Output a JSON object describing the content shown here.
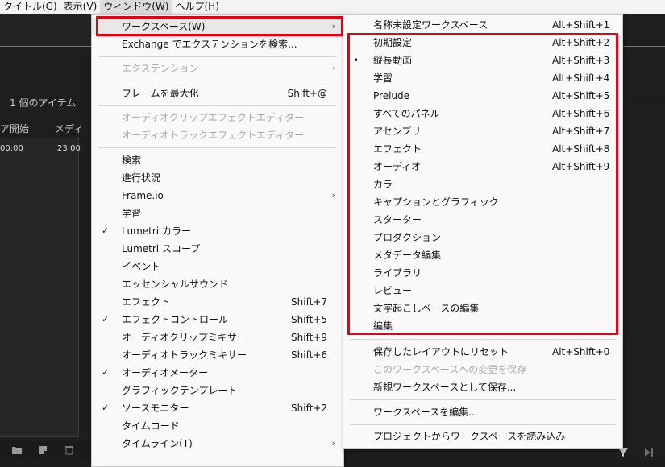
{
  "menubar": {
    "items": [
      "タイトル(G)",
      "表示(V)",
      "ウィンドウ(W)",
      "ヘルプ(H)"
    ]
  },
  "panel": {
    "item_count": "1 個のアイテム",
    "col1": "ア開始",
    "col2": "メディ",
    "cell1": "00:00",
    "cell2": "23:00"
  },
  "window_menu": {
    "items": [
      {
        "label": "ワークスペース(W)",
        "shortcut": "",
        "submenu": true,
        "disabled": false,
        "checked": false
      },
      {
        "label": "Exchange でエクステンションを検索...",
        "shortcut": "",
        "submenu": false,
        "disabled": false,
        "checked": false
      },
      {
        "label": "エクステンション",
        "shortcut": "",
        "submenu": true,
        "disabled": true,
        "checked": false
      },
      {
        "label": "フレームを最大化",
        "shortcut": "Shift+@",
        "submenu": false,
        "disabled": false,
        "checked": false
      },
      {
        "label": "オーディオクリップエフェクトエディター",
        "shortcut": "",
        "submenu": false,
        "disabled": true,
        "checked": false
      },
      {
        "label": "オーディオトラックエフェクトエディター",
        "shortcut": "",
        "submenu": false,
        "disabled": true,
        "checked": false
      },
      {
        "label": "検索",
        "shortcut": "",
        "submenu": false,
        "disabled": false,
        "checked": false
      },
      {
        "label": "進行状況",
        "shortcut": "",
        "submenu": false,
        "disabled": false,
        "checked": false
      },
      {
        "label": "Frame.io",
        "shortcut": "",
        "submenu": true,
        "disabled": false,
        "checked": false
      },
      {
        "label": "学習",
        "shortcut": "",
        "submenu": false,
        "disabled": false,
        "checked": false
      },
      {
        "label": "Lumetri カラー",
        "shortcut": "",
        "submenu": false,
        "disabled": false,
        "checked": true
      },
      {
        "label": "Lumetri スコープ",
        "shortcut": "",
        "submenu": false,
        "disabled": false,
        "checked": false
      },
      {
        "label": "イベント",
        "shortcut": "",
        "submenu": false,
        "disabled": false,
        "checked": false
      },
      {
        "label": "エッセンシャルサウンド",
        "shortcut": "",
        "submenu": false,
        "disabled": false,
        "checked": false
      },
      {
        "label": "エフェクト",
        "shortcut": "Shift+7",
        "submenu": false,
        "disabled": false,
        "checked": false
      },
      {
        "label": "エフェクトコントロール",
        "shortcut": "Shift+5",
        "submenu": false,
        "disabled": false,
        "checked": true
      },
      {
        "label": "オーディオクリップミキサー",
        "shortcut": "Shift+9",
        "submenu": false,
        "disabled": false,
        "checked": false
      },
      {
        "label": "オーディオトラックミキサー",
        "shortcut": "Shift+6",
        "submenu": false,
        "disabled": false,
        "checked": false
      },
      {
        "label": "オーディオメーター",
        "shortcut": "",
        "submenu": false,
        "disabled": false,
        "checked": true
      },
      {
        "label": "グラフィックテンプレート",
        "shortcut": "",
        "submenu": false,
        "disabled": false,
        "checked": false
      },
      {
        "label": "ソースモニター",
        "shortcut": "Shift+2",
        "submenu": false,
        "disabled": false,
        "checked": true
      },
      {
        "label": "タイムコード",
        "shortcut": "",
        "submenu": false,
        "disabled": false,
        "checked": false
      },
      {
        "label": "タイムライン(T)",
        "shortcut": "",
        "submenu": true,
        "disabled": false,
        "checked": false
      }
    ]
  },
  "workspace_menu": {
    "items": [
      {
        "label": "名称未設定ワークスペース",
        "shortcut": "Alt+Shift+1",
        "disabled": false,
        "current": false
      },
      {
        "label": "初期設定",
        "shortcut": "Alt+Shift+2",
        "disabled": false,
        "current": false
      },
      {
        "label": "縦長動画",
        "shortcut": "Alt+Shift+3",
        "disabled": false,
        "current": true
      },
      {
        "label": "学習",
        "shortcut": "Alt+Shift+4",
        "disabled": false,
        "current": false
      },
      {
        "label": "Prelude",
        "shortcut": "Alt+Shift+5",
        "disabled": false,
        "current": false
      },
      {
        "label": "すべてのパネル",
        "shortcut": "Alt+Shift+6",
        "disabled": false,
        "current": false
      },
      {
        "label": "アセンブリ",
        "shortcut": "Alt+Shift+7",
        "disabled": false,
        "current": false
      },
      {
        "label": "エフェクト",
        "shortcut": "Alt+Shift+8",
        "disabled": false,
        "current": false
      },
      {
        "label": "オーディオ",
        "shortcut": "Alt+Shift+9",
        "disabled": false,
        "current": false
      },
      {
        "label": "カラー",
        "shortcut": "",
        "disabled": false,
        "current": false
      },
      {
        "label": "キャプションとグラフィック",
        "shortcut": "",
        "disabled": false,
        "current": false
      },
      {
        "label": "スターター",
        "shortcut": "",
        "disabled": false,
        "current": false
      },
      {
        "label": "プロダクション",
        "shortcut": "",
        "disabled": false,
        "current": false
      },
      {
        "label": "メタデータ編集",
        "shortcut": "",
        "disabled": false,
        "current": false
      },
      {
        "label": "ライブラリ",
        "shortcut": "",
        "disabled": false,
        "current": false
      },
      {
        "label": "レビュー",
        "shortcut": "",
        "disabled": false,
        "current": false
      },
      {
        "label": "文字起こしベースの編集",
        "shortcut": "",
        "disabled": false,
        "current": false
      },
      {
        "label": "編集",
        "shortcut": "",
        "disabled": false,
        "current": false
      },
      {
        "label": "保存したレイアウトにリセット",
        "shortcut": "Alt+Shift+0",
        "disabled": false,
        "current": false
      },
      {
        "label": "このワークスペースへの変更を保存",
        "shortcut": "",
        "disabled": true,
        "current": false
      },
      {
        "label": "新規ワークスペースとして保存...",
        "shortcut": "",
        "disabled": false,
        "current": false
      },
      {
        "label": "ワークスペースを編集...",
        "shortcut": "",
        "disabled": false,
        "current": false
      },
      {
        "label": "プロジェクトからワークスペースを読み込み",
        "shortcut": "",
        "disabled": false,
        "current": false
      }
    ]
  },
  "colors": {
    "highlight_box": "#e60012",
    "accent_line": "#2d8ceb"
  },
  "icons": [
    "folder-icon",
    "new-item-icon",
    "trash-icon",
    "filter-icon",
    "play-icon",
    "chevron-right-icon",
    "check-icon",
    "bullet-icon"
  ]
}
